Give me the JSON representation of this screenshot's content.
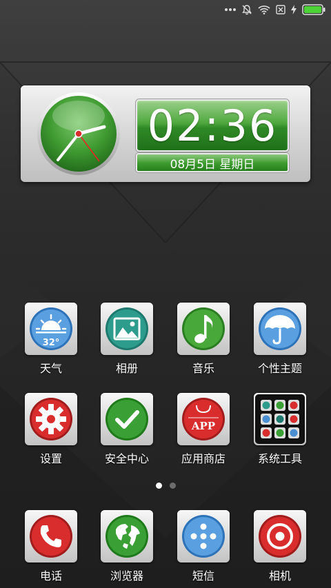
{
  "clock": {
    "time": "02:36",
    "date": "08月5日 星期日"
  },
  "apps_row1": [
    {
      "label": "天气",
      "icon": "weather-icon",
      "temp": "32°"
    },
    {
      "label": "相册",
      "icon": "gallery-icon"
    },
    {
      "label": "音乐",
      "icon": "music-icon"
    },
    {
      "label": "个性主题",
      "icon": "umbrella-icon"
    }
  ],
  "apps_row2": [
    {
      "label": "设置",
      "icon": "gear-icon"
    },
    {
      "label": "安全中心",
      "icon": "checkmark-icon"
    },
    {
      "label": "应用商店",
      "icon": "app-store-icon",
      "badge": "APP"
    },
    {
      "label": "系统工具",
      "icon": "tools-folder-icon"
    }
  ],
  "dock": [
    {
      "label": "电话",
      "icon": "phone-icon"
    },
    {
      "label": "浏览器",
      "icon": "globe-icon"
    },
    {
      "label": "短信",
      "icon": "message-icon"
    },
    {
      "label": "相机",
      "icon": "camera-icon"
    }
  ],
  "pager": {
    "pages": 2,
    "active": 1
  },
  "colors": {
    "accent_green": "#3c9a2e",
    "battery_green": "#4cd137",
    "red": "#d92d2d",
    "blue": "#4a8fd1"
  }
}
